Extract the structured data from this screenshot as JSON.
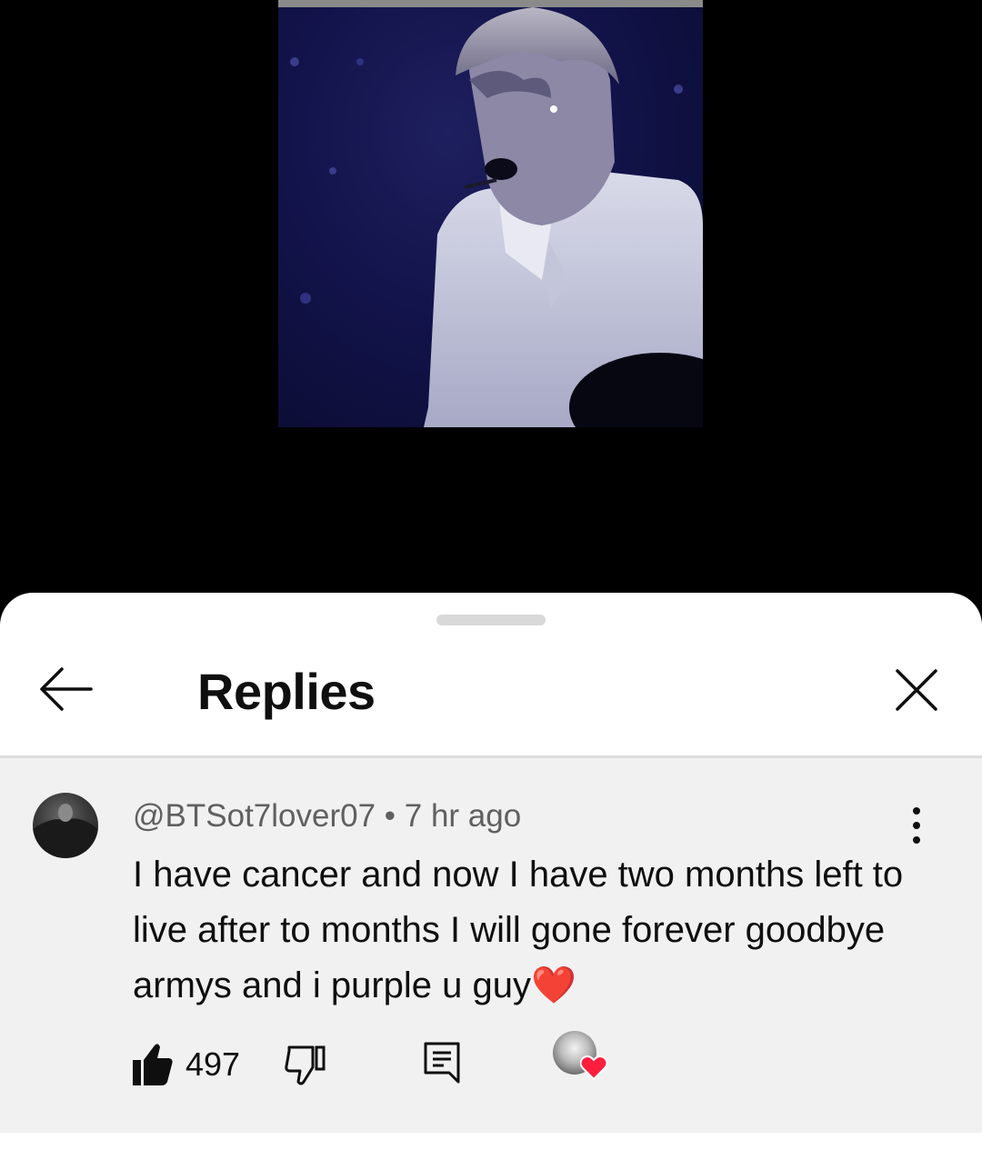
{
  "sheet": {
    "title": "Replies"
  },
  "comment": {
    "author": "@BTSot7lover07",
    "separator": " • ",
    "time": "7 hr ago",
    "text": "I have cancer and now I have two months left to live after to months I will gone forever goodbye armys and i purple u guy",
    "emoji": "❤️",
    "likes": "497"
  },
  "icons": {
    "back": "arrow-left-icon",
    "close": "close-icon",
    "more": "more-vert-icon",
    "like": "thumb-up-filled-icon",
    "dislike": "thumb-down-outline-icon",
    "reply": "comment-icon",
    "creator_heart": "creator-heart-icon"
  },
  "colors": {
    "heart": "#e21b1b",
    "sheet_bg": "#ffffff",
    "comment_bg": "#f1f1f1",
    "text": "#0f0f0f",
    "meta": "#606060"
  }
}
